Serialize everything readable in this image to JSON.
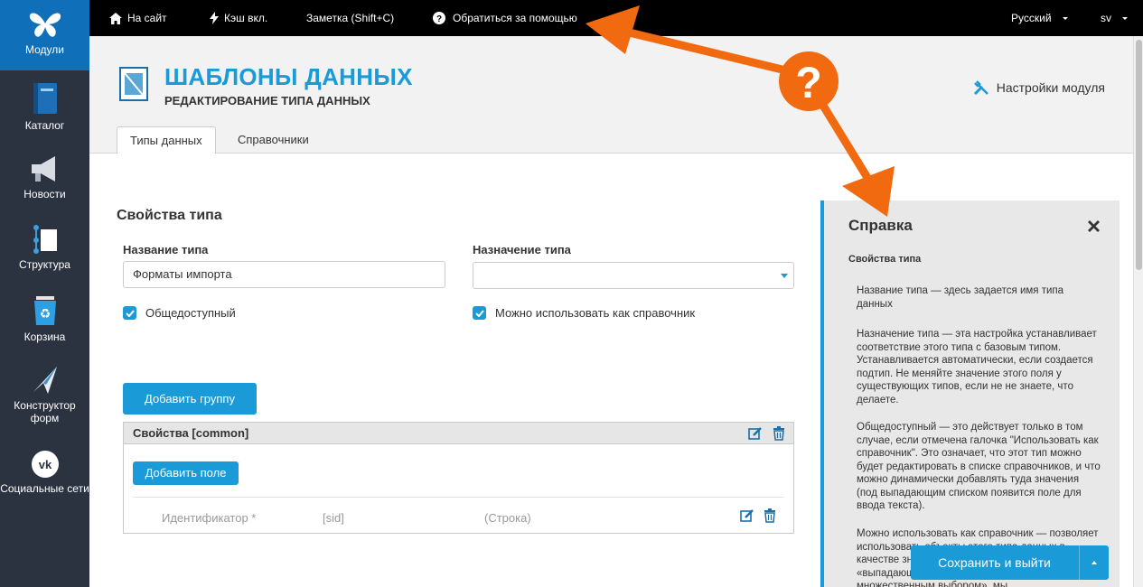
{
  "sidebar": {
    "items": [
      {
        "label": "Модули",
        "icon": "butterfly-icon",
        "active": true
      },
      {
        "label": "Каталог",
        "icon": "book-icon"
      },
      {
        "label": "Новости",
        "icon": "megaphone-icon"
      },
      {
        "label": "Структура",
        "icon": "structure-icon"
      },
      {
        "label": "Корзина",
        "icon": "recycle-bin-icon"
      },
      {
        "label": "Конструктор форм",
        "icon": "paper-plane-icon"
      },
      {
        "label": "Социальные сети",
        "icon": "vk-icon"
      }
    ]
  },
  "topbar": {
    "site": "На сайт",
    "cache": "Кэш вкл.",
    "note": "Заметка (Shift+C)",
    "help": "Обратиться за помощью",
    "language": "Русский",
    "user": "sv"
  },
  "header": {
    "title": "ШАБЛОНЫ ДАННЫХ",
    "subtitle": "РЕДАКТИРОВАНИЕ ТИПА ДАННЫХ",
    "module_settings": "Настройки модуля",
    "tabs": [
      "Типы данных",
      "Справочники"
    ]
  },
  "form": {
    "section_title": "Свойства типа",
    "type_name_label": "Название типа",
    "type_name_value": "Форматы импорта",
    "type_purpose_label": "Назначение типа",
    "type_purpose_value": "",
    "public_label": "Общедоступный",
    "as_reference_label": "Можно использовать как справочник",
    "add_group": "Добавить группу",
    "group_title": "Свойства [common]",
    "add_field": "Добавить поле",
    "field": {
      "name": "Идентификатор *",
      "sid": "[sid]",
      "type": "(Строка)"
    }
  },
  "help": {
    "title": "Справка",
    "subtitle": "Свойства типа",
    "paragraphs": [
      "Название типа — здесь задается имя типа данных",
      "Назначение типа — эта настройка устанавливает соответствие этого типа с базовым типом. Устанавливается автоматически, если создается подтип. Не меняйте значение этого поля у существующих типов, если не не знаете, что делаете.",
      "Общедоступный — это действует только в том случае, если отмечена галочка \"Использовать как справочник\". Это означает, что этот тип можно будет редактировать в списке справочников, и что можно динамически добавлять туда значения (под выпадающим списком появится поле для ввода текста).",
      "Можно использовать как справочник — позволяет использовать объекты этого типа данных в качестве значений полей при создании поля типа «выпадающий список» или «список с множественным выбором», мы"
    ]
  },
  "save_button": "Сохранить и выйти",
  "annotation": {
    "badge": "?",
    "color": "#f26a10"
  },
  "colors": {
    "accent": "#1a9ad6",
    "sidebar": "#2c3340",
    "active": "#0f6fb8",
    "annotation": "#f26a10"
  }
}
